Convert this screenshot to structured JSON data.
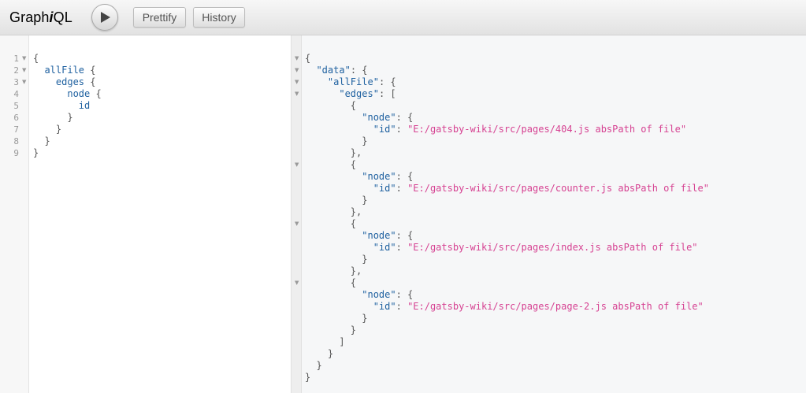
{
  "toolbar": {
    "logo_prefix": "Graph",
    "logo_italic": "i",
    "logo_suffix": "QL",
    "run_icon": "play-icon",
    "prettify_label": "Prettify",
    "history_label": "History"
  },
  "query": {
    "lines": [
      {
        "num": "1",
        "fold": true,
        "tokens": [
          {
            "t": "{",
            "c": "punc"
          }
        ]
      },
      {
        "num": "2",
        "fold": true,
        "tokens": [
          {
            "t": "  ",
            "c": "punc"
          },
          {
            "t": "allFile",
            "c": "field"
          },
          {
            "t": " {",
            "c": "punc"
          }
        ]
      },
      {
        "num": "3",
        "fold": true,
        "tokens": [
          {
            "t": "    ",
            "c": "punc"
          },
          {
            "t": "edges",
            "c": "field"
          },
          {
            "t": " {",
            "c": "punc"
          }
        ]
      },
      {
        "num": "4",
        "fold": false,
        "tokens": [
          {
            "t": "      ",
            "c": "punc"
          },
          {
            "t": "node",
            "c": "field"
          },
          {
            "t": " {",
            "c": "punc"
          }
        ]
      },
      {
        "num": "5",
        "fold": false,
        "tokens": [
          {
            "t": "        ",
            "c": "punc"
          },
          {
            "t": "id",
            "c": "field"
          }
        ]
      },
      {
        "num": "6",
        "fold": false,
        "tokens": [
          {
            "t": "      }",
            "c": "punc"
          }
        ]
      },
      {
        "num": "7",
        "fold": false,
        "tokens": [
          {
            "t": "    }",
            "c": "punc"
          }
        ]
      },
      {
        "num": "8",
        "fold": false,
        "tokens": [
          {
            "t": "  }",
            "c": "punc"
          }
        ]
      },
      {
        "num": "9",
        "fold": false,
        "tokens": [
          {
            "t": "}",
            "c": "punc"
          }
        ]
      }
    ]
  },
  "result": {
    "lines": [
      {
        "fold": true,
        "tokens": [
          {
            "t": "{",
            "c": "punc"
          }
        ]
      },
      {
        "fold": true,
        "tokens": [
          {
            "t": "  ",
            "c": "punc"
          },
          {
            "t": "\"data\"",
            "c": "key"
          },
          {
            "t": ": {",
            "c": "punc"
          }
        ]
      },
      {
        "fold": true,
        "tokens": [
          {
            "t": "    ",
            "c": "punc"
          },
          {
            "t": "\"allFile\"",
            "c": "key"
          },
          {
            "t": ": {",
            "c": "punc"
          }
        ]
      },
      {
        "fold": true,
        "tokens": [
          {
            "t": "      ",
            "c": "punc"
          },
          {
            "t": "\"edges\"",
            "c": "key"
          },
          {
            "t": ": [",
            "c": "punc"
          }
        ]
      },
      {
        "fold": false,
        "tokens": [
          {
            "t": "        {",
            "c": "punc"
          }
        ]
      },
      {
        "fold": false,
        "tokens": [
          {
            "t": "          ",
            "c": "punc"
          },
          {
            "t": "\"node\"",
            "c": "key"
          },
          {
            "t": ": {",
            "c": "punc"
          }
        ]
      },
      {
        "fold": false,
        "tokens": [
          {
            "t": "            ",
            "c": "punc"
          },
          {
            "t": "\"id\"",
            "c": "key"
          },
          {
            "t": ": ",
            "c": "punc"
          },
          {
            "t": "\"E:/gatsby-wiki/src/pages/404.js absPath of file\"",
            "c": "str"
          }
        ]
      },
      {
        "fold": false,
        "tokens": [
          {
            "t": "          }",
            "c": "punc"
          }
        ]
      },
      {
        "fold": false,
        "tokens": [
          {
            "t": "        },",
            "c": "punc"
          }
        ]
      },
      {
        "fold": true,
        "tokens": [
          {
            "t": "        {",
            "c": "punc"
          }
        ]
      },
      {
        "fold": false,
        "tokens": [
          {
            "t": "          ",
            "c": "punc"
          },
          {
            "t": "\"node\"",
            "c": "key"
          },
          {
            "t": ": {",
            "c": "punc"
          }
        ]
      },
      {
        "fold": false,
        "tokens": [
          {
            "t": "            ",
            "c": "punc"
          },
          {
            "t": "\"id\"",
            "c": "key"
          },
          {
            "t": ": ",
            "c": "punc"
          },
          {
            "t": "\"E:/gatsby-wiki/src/pages/counter.js absPath of file\"",
            "c": "str"
          }
        ]
      },
      {
        "fold": false,
        "tokens": [
          {
            "t": "          }",
            "c": "punc"
          }
        ]
      },
      {
        "fold": false,
        "tokens": [
          {
            "t": "        },",
            "c": "punc"
          }
        ]
      },
      {
        "fold": true,
        "tokens": [
          {
            "t": "        {",
            "c": "punc"
          }
        ]
      },
      {
        "fold": false,
        "tokens": [
          {
            "t": "          ",
            "c": "punc"
          },
          {
            "t": "\"node\"",
            "c": "key"
          },
          {
            "t": ": {",
            "c": "punc"
          }
        ]
      },
      {
        "fold": false,
        "tokens": [
          {
            "t": "            ",
            "c": "punc"
          },
          {
            "t": "\"id\"",
            "c": "key"
          },
          {
            "t": ": ",
            "c": "punc"
          },
          {
            "t": "\"E:/gatsby-wiki/src/pages/index.js absPath of file\"",
            "c": "str"
          }
        ]
      },
      {
        "fold": false,
        "tokens": [
          {
            "t": "          }",
            "c": "punc"
          }
        ]
      },
      {
        "fold": false,
        "tokens": [
          {
            "t": "        },",
            "c": "punc"
          }
        ]
      },
      {
        "fold": true,
        "tokens": [
          {
            "t": "        {",
            "c": "punc"
          }
        ]
      },
      {
        "fold": false,
        "tokens": [
          {
            "t": "          ",
            "c": "punc"
          },
          {
            "t": "\"node\"",
            "c": "key"
          },
          {
            "t": ": {",
            "c": "punc"
          }
        ]
      },
      {
        "fold": false,
        "tokens": [
          {
            "t": "            ",
            "c": "punc"
          },
          {
            "t": "\"id\"",
            "c": "key"
          },
          {
            "t": ": ",
            "c": "punc"
          },
          {
            "t": "\"E:/gatsby-wiki/src/pages/page-2.js absPath of file\"",
            "c": "str"
          }
        ]
      },
      {
        "fold": false,
        "tokens": [
          {
            "t": "          }",
            "c": "punc"
          }
        ]
      },
      {
        "fold": false,
        "tokens": [
          {
            "t": "        }",
            "c": "punc"
          }
        ]
      },
      {
        "fold": false,
        "tokens": [
          {
            "t": "      ]",
            "c": "punc"
          }
        ]
      },
      {
        "fold": false,
        "tokens": [
          {
            "t": "    }",
            "c": "punc"
          }
        ]
      },
      {
        "fold": false,
        "tokens": [
          {
            "t": "  }",
            "c": "punc"
          }
        ]
      },
      {
        "fold": false,
        "tokens": [
          {
            "t": "}",
            "c": "punc"
          }
        ]
      }
    ]
  },
  "colors": {
    "field": "#1f61a0",
    "key": "#1f61a0",
    "string": "#d64292",
    "punctuation": "#555555"
  }
}
